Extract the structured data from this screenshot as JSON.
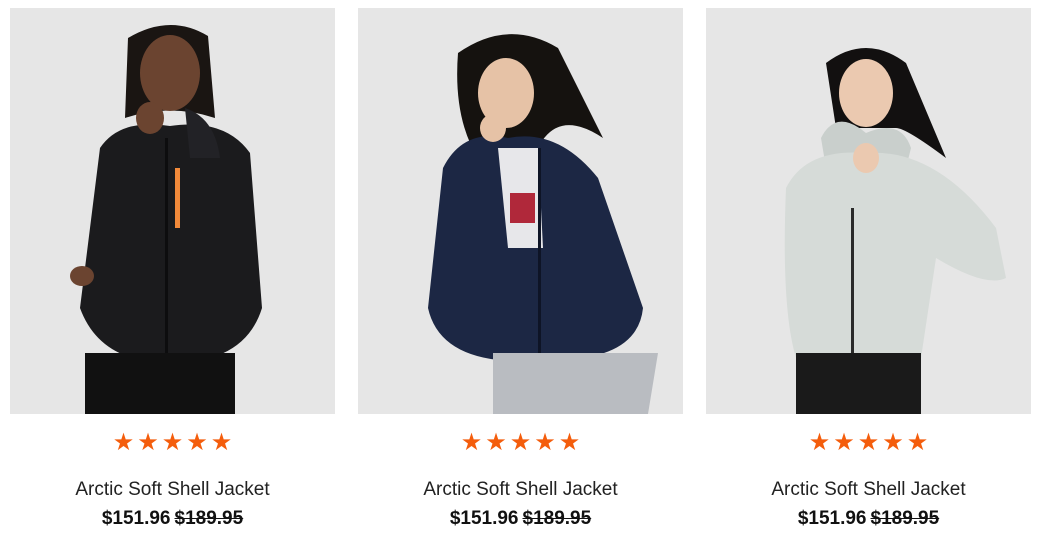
{
  "products": [
    {
      "image_alt": "Model wearing black Arctic Soft Shell Jacket",
      "jacket_color": "#1b1b1d",
      "accent_color": "#f28a3a",
      "pants_color": "#111111",
      "skin_color": "#6b4430",
      "hair_color": "#1a1512",
      "rating_stars": 5,
      "star_glyph": "★",
      "name": "Arctic Soft Shell Jacket",
      "price": "$151.96",
      "original_price": "$189.95"
    },
    {
      "image_alt": "Model wearing navy Arctic Soft Shell Jacket",
      "jacket_color": "#1c2744",
      "accent_color": "#e7e7ea",
      "pants_color": "#b9bcc1",
      "skin_color": "#e6c2a6",
      "hair_color": "#15120f",
      "rating_stars": 5,
      "star_glyph": "★",
      "name": "Arctic Soft Shell Jacket",
      "price": "$151.96",
      "original_price": "$189.95"
    },
    {
      "image_alt": "Model wearing light grey Arctic Soft Shell Jacket",
      "jacket_color": "#d6dbd8",
      "accent_color": "#2a2a2a",
      "pants_color": "#1a1a1a",
      "skin_color": "#ebc9b0",
      "hair_color": "#121010",
      "rating_stars": 5,
      "star_glyph": "★",
      "name": "Arctic Soft Shell Jacket",
      "price": "$151.96",
      "original_price": "$189.95"
    }
  ]
}
